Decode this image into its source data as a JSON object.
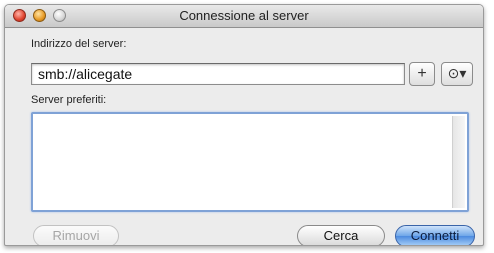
{
  "window": {
    "title": "Connessione al server"
  },
  "address": {
    "label": "Indirizzo del server:",
    "value": "smb://alicegate",
    "add_button": "+",
    "recent_button": "⊙▾"
  },
  "favorites": {
    "label": "Server preferiti:",
    "items": []
  },
  "buttons": {
    "remove": "Rimuovi",
    "search": "Cerca",
    "connect": "Connetti"
  }
}
